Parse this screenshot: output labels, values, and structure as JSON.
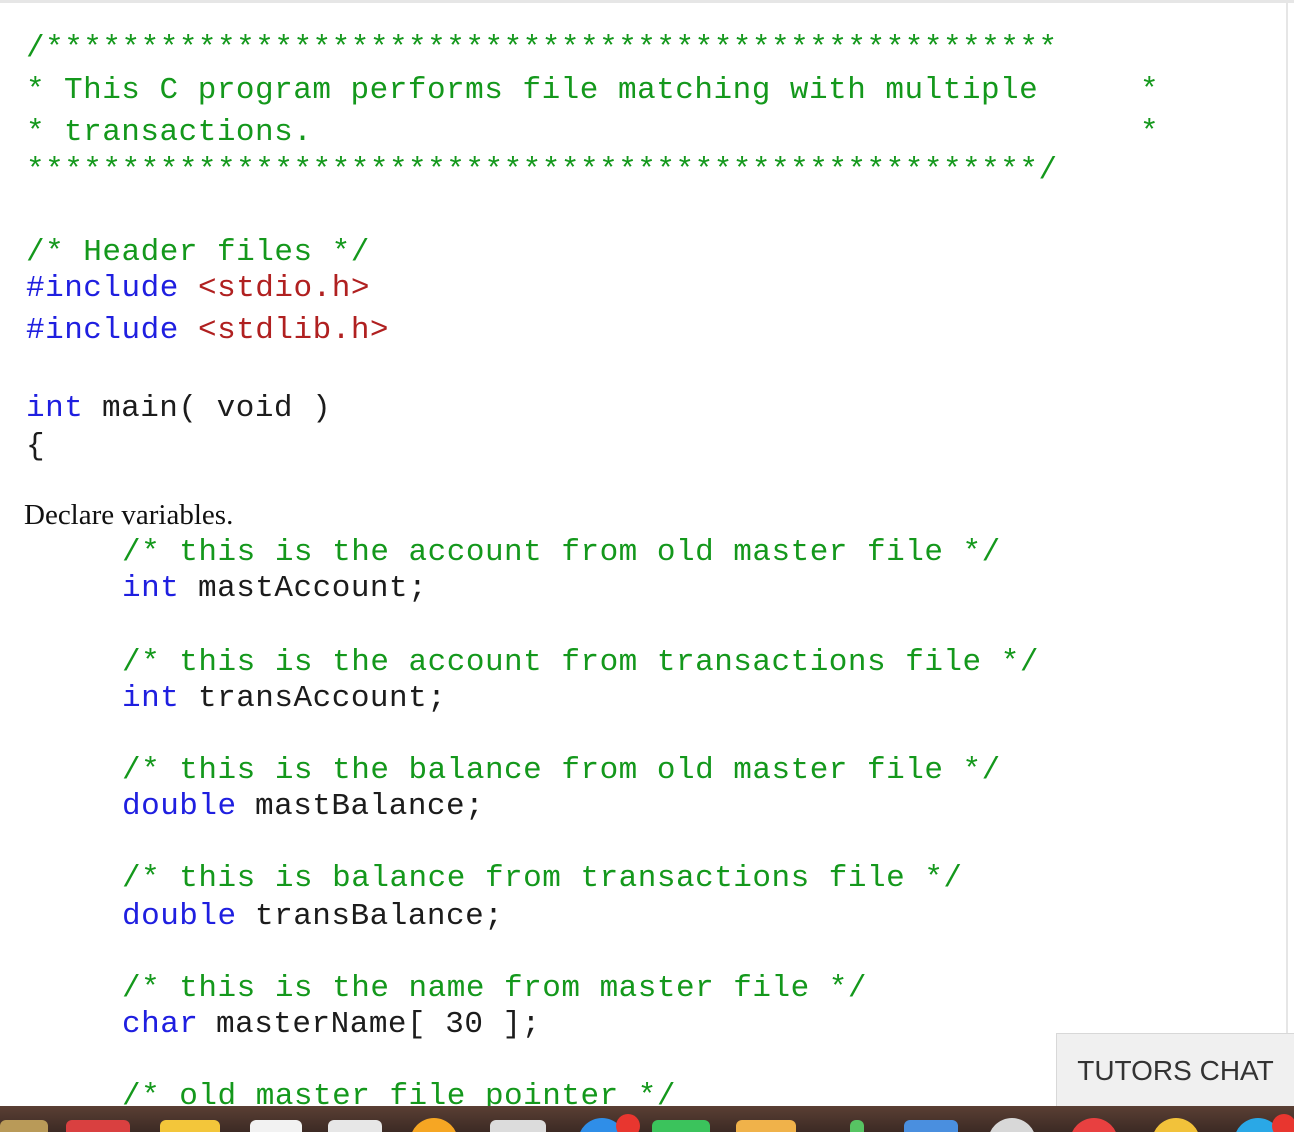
{
  "code": {
    "banner_top": "/*****************************************************",
    "banner_line1_star": "*",
    "banner_line1_text": "This C program performs file matching with multiple",
    "banner_line1_end": "*",
    "banner_line2_star": "*",
    "banner_line2_text": "transactions.",
    "banner_line2_end": "*",
    "banner_bottom": "*****************************************************/",
    "header_comment": "/* Header files */",
    "include_directive": "#include",
    "include1_file": "<stdio.h>",
    "include2_file": "<stdlib.h>",
    "main_type": "int",
    "main_sig": "main( void )",
    "open_brace": "{",
    "declare_text": "Declare variables.",
    "decls": [
      {
        "comment": "/* this is the account from old master file */",
        "type": "int",
        "name": "mastAccount;"
      },
      {
        "comment": "/* this is the account from transactions file */",
        "type": "int",
        "name": "transAccount;"
      },
      {
        "comment": "/* this is the balance from old master file */",
        "type": "double",
        "name": "mastBalance;"
      },
      {
        "comment": "/* this is balance from transactions file */",
        "type": "double",
        "name": "transBalance;"
      },
      {
        "comment": "/* this is the name from master file */",
        "type": "char",
        "name": "masterName[ 30 ];"
      }
    ],
    "last_comment": "/* old master file pointer */"
  },
  "chat": {
    "label": "TUTORS CHAT"
  },
  "colors": {
    "comment": "#14981c",
    "keyword": "#1f1fe0",
    "include_file": "#b02020"
  },
  "dock": {
    "icons": [
      "notes-icon",
      "calendar-icon",
      "finder-icon",
      "contacts-icon",
      "chrome-icon",
      "mail-icon",
      "appstore-icon",
      "messages-icon",
      "textedit-icon",
      "downloads-icon",
      "preview-icon",
      "safari-icon",
      "music-icon",
      "photos-icon",
      "launchpad-icon"
    ]
  }
}
